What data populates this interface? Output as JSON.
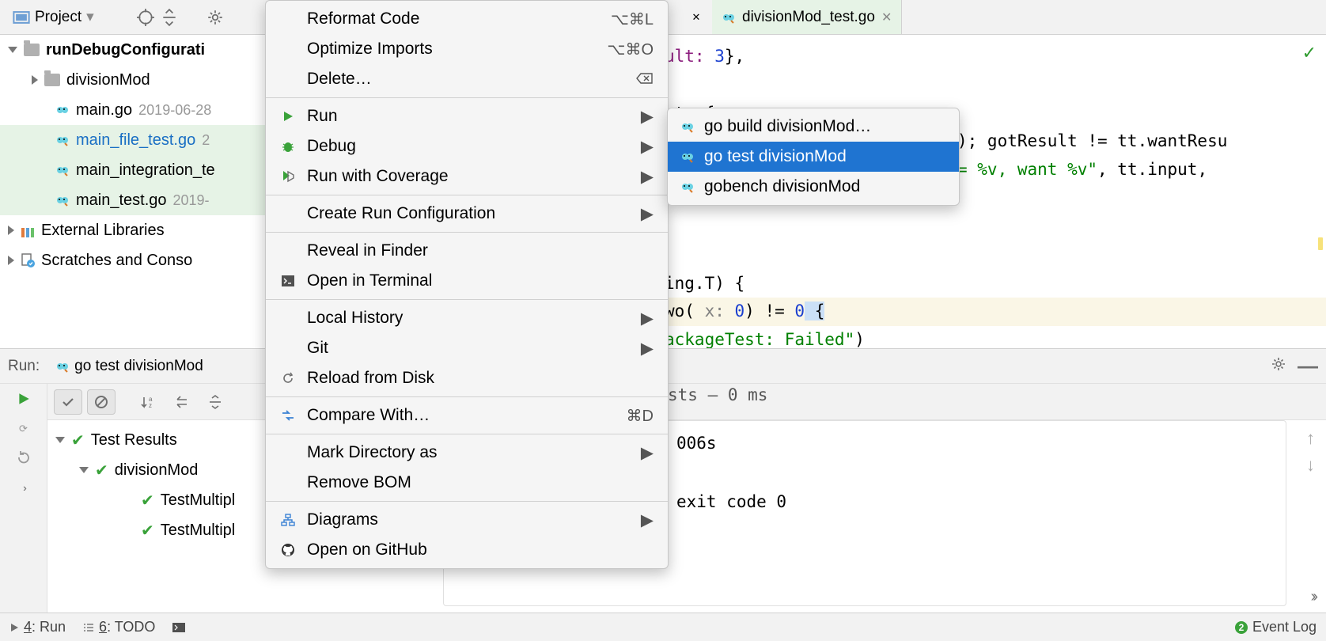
{
  "toolbar": {
    "project_label": "Project"
  },
  "tree": {
    "root": "runDebugConfigurati",
    "division": "divisionMod",
    "files": {
      "main": "main.go",
      "main_date": "2019-06-28",
      "main_file_test": "main_file_test.go",
      "main_file_test_date": "2",
      "main_integration": "main_integration_te",
      "main_test": "main_test.go",
      "main_test_date": "2019-"
    },
    "external": "External Libraries",
    "scratches": "Scratches and Conso"
  },
  "tabs": {
    "active": "divisionMod_test.go"
  },
  "code": {
    "l1a": "ult:",
    "l1b": " 3",
    "l1c": "},",
    "l2": "sts {",
    "l3a": "); gotResult != tt.wantResu",
    "l4a": " = %v, want %v\"",
    "l4b": ", tt.input,",
    "l5a": "ing.T) {",
    "l6a": "wo(",
    "l6b": " x: ",
    "l6c": "0",
    "l6d": ") != ",
    "l6e": "0",
    "l6f": " {",
    "l7a": "ackageTest: Failed\"",
    "l7b": ")"
  },
  "context_menu": {
    "reformat": "Reformat Code",
    "reformat_sc": "⌥⌘L",
    "optimize": "Optimize Imports",
    "optimize_sc": "⌥⌘O",
    "delete": "Delete…",
    "run": "Run",
    "debug": "Debug",
    "coverage": "Run with Coverage",
    "create_run": "Create Run Configuration",
    "reveal": "Reveal in Finder",
    "terminal": "Open in Terminal",
    "local_history": "Local History",
    "git": "Git",
    "reload": "Reload from Disk",
    "compare": "Compare With…",
    "compare_sc": "⌘D",
    "mark_dir": "Mark Directory as",
    "remove_bom": "Remove BOM",
    "diagrams": "Diagrams",
    "open_github": "Open on GitHub"
  },
  "submenu": {
    "build": "go build divisionMod…",
    "test": "go test divisionMod",
    "bench": "gobench divisionMod"
  },
  "run": {
    "label": "Run:",
    "config": "go test divisionMod",
    "tests_header": "sts – 0 ms",
    "tree": {
      "root": "Test Results",
      "mod": "divisionMod",
      "t1": "TestMultipl",
      "t2": "TestMultipl"
    },
    "console_l1": "006s",
    "console_l2": "exit code 0"
  },
  "status": {
    "run_tab": "4: Run",
    "todo_tab": "6: TODO",
    "event_log": "Event Log"
  }
}
